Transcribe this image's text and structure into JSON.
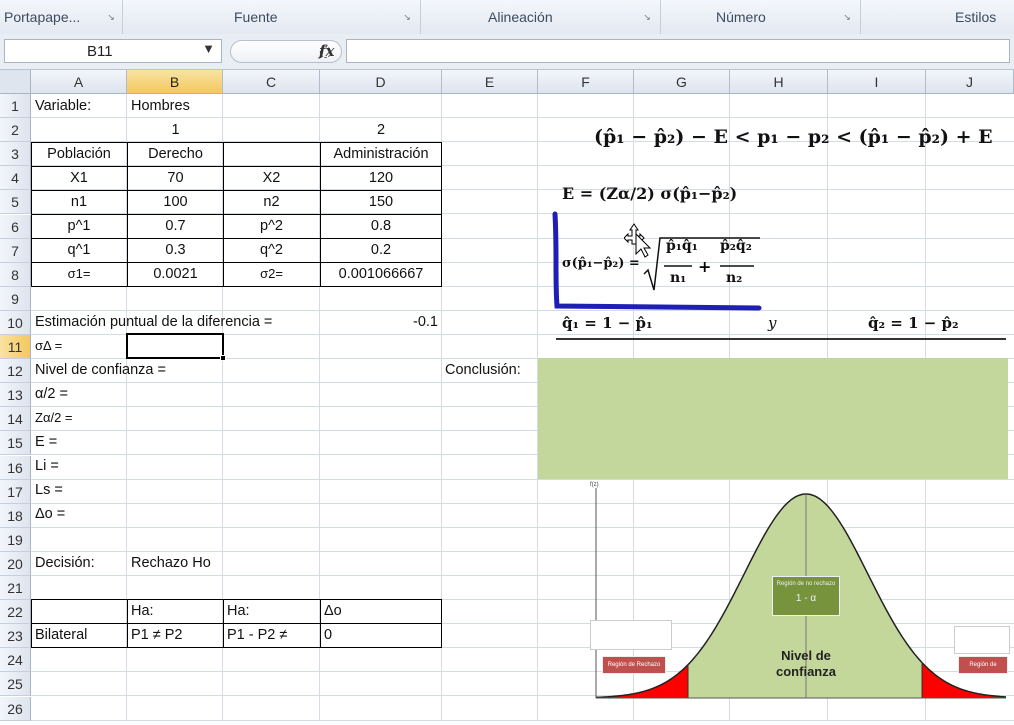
{
  "ribbon": {
    "groups": [
      {
        "label": "Portapape..."
      },
      {
        "label": "Fuente"
      },
      {
        "label": "Alineación"
      },
      {
        "label": "Número"
      },
      {
        "label": "Estilos"
      }
    ]
  },
  "formula_bar": {
    "name_box": "B11",
    "fx_label": "fx",
    "content": ""
  },
  "columns": [
    "A",
    "B",
    "C",
    "D",
    "E",
    "F",
    "G",
    "H",
    "I",
    "J"
  ],
  "rows": [
    "1",
    "2",
    "3",
    "4",
    "5",
    "6",
    "7",
    "8",
    "9",
    "10",
    "11",
    "12",
    "13",
    "14",
    "15",
    "16",
    "17",
    "18",
    "19",
    "20",
    "21",
    "22",
    "23",
    "24",
    "25",
    "26"
  ],
  "cells": {
    "A1": "Variable:",
    "B1": "Hombres",
    "B2": "1",
    "D2": "2",
    "A3": "Población",
    "B3": "Derecho",
    "D3": "Administración",
    "A4": "X1",
    "B4": "70",
    "C4": "X2",
    "D4": "120",
    "A5": "n1",
    "B5": "100",
    "C5": "n2",
    "D5": "150",
    "A6": "p^1",
    "B6": "0.7",
    "C6": "p^2",
    "D6": "0.8",
    "A7": "q^1",
    "B7": "0.3",
    "C7": "q^2",
    "D7": "0.2",
    "A8": "σ1=",
    "B8": "0.0021",
    "C8": "σ2=",
    "D8": "0.001066667",
    "A10": "Estimación puntual de la diferencia =",
    "D10": "-0.1",
    "A11": "σΔ =",
    "A12": "Nivel de confianza =",
    "E12": "Conclusión:",
    "A13": "α/2 =",
    "A14": "Zα/2 =",
    "A15": "E =",
    "A16": "Li =",
    "A17": "Ls =",
    "A18": "Δo =",
    "A20": "Decisión:",
    "B20": "Rechazo Ho",
    "B22": "Ha:",
    "C22": "Ha:",
    "D22": "Δo",
    "A23": "Bilateral",
    "B23": "P1 ≠ P2",
    "C23": "P1 - P2 ≠",
    "D23": "0"
  },
  "formulas": {
    "interval": "(p̂₁ − p̂₂) − E < p₁ − p₂ < (p̂₁ − p̂₂) + E",
    "error": "E = (Zα/2) σ(p̂₁−p̂₂)",
    "sigma_lhs": "σ(p̂₁−p̂₂) =",
    "sigma_num1": "p̂₁q̂₁",
    "sigma_den1": "n₁",
    "sigma_num2": "p̂₂q̂₂",
    "sigma_den2": "n₂",
    "q1": "q̂₁ = 1 − p̂₁",
    "y": "y",
    "q2": "q̂₂ = 1 − p̂₂"
  },
  "chart": {
    "center_label_line1": "Nivel de",
    "center_label_line2": "confianza",
    "region_rechazo_left": "Región de Rechazo",
    "region_rechazo_right": "Región de Rechazo",
    "region_aceptacion": "Región de no rechazo",
    "one_minus_alpha": "1 - α",
    "y_label": "f(z)"
  },
  "colors": {
    "selection_header": "#f3c85f",
    "green_fill": "#c3d69b",
    "curve_fill": "#c4d79b",
    "reject_fill": "#ff0000",
    "annotation_blue": "#1f1fb5"
  }
}
